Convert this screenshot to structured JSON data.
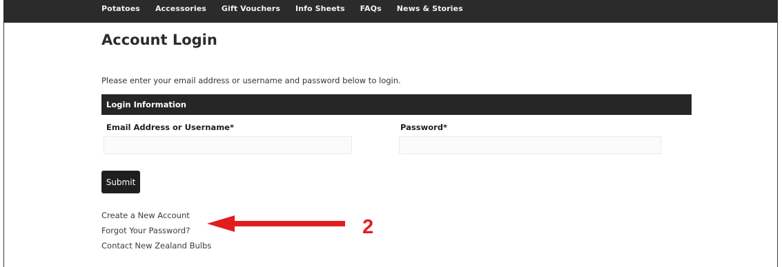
{
  "nav": {
    "items": [
      "Potatoes",
      "Accessories",
      "Gift Vouchers",
      "Info Sheets",
      "FAQs",
      "News & Stories"
    ]
  },
  "page": {
    "title": "Account Login",
    "instructions": "Please enter your email address or username and password below to login."
  },
  "form": {
    "section_title": "Login Information",
    "email_label": "Email Address or Username*",
    "email_value": "",
    "password_label": "Password*",
    "password_value": "",
    "submit_label": "Submit"
  },
  "links": {
    "create_account": "Create a New Account",
    "forgot_password": "Forgot Your Password?",
    "contact": "Contact New Zealand Bulbs"
  },
  "annotation": {
    "step_number": "2",
    "color": "#e21d1d"
  }
}
